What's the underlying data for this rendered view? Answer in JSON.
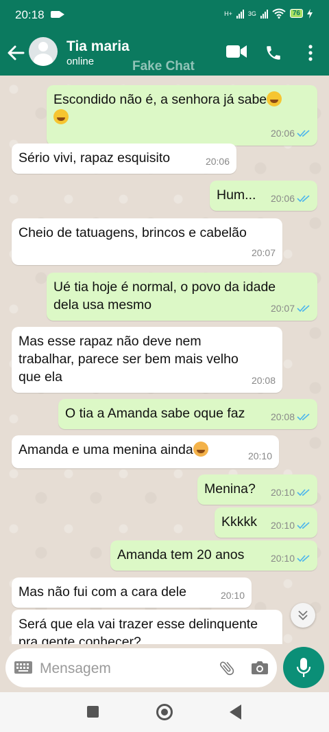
{
  "status_bar": {
    "time": "20:18",
    "network_1": "H+",
    "network_2": "3G",
    "battery": "76"
  },
  "header": {
    "contact_name": "Tia maria",
    "contact_status": "online",
    "watermark": "Fake Chat"
  },
  "colors": {
    "header": "#0b7a5f",
    "outgoing": "#dcf8c6",
    "incoming": "#ffffff",
    "tick": "#4fb6ec",
    "mic": "#0b8f77"
  },
  "messages": [
    {
      "dir": "out",
      "text": "Escondido não é, a senhora já sabe",
      "emoji": "joy-emoji",
      "time": "20:06"
    },
    {
      "dir": "in",
      "text": "Sério vivi, rapaz esquisito",
      "time": "20:06"
    },
    {
      "dir": "out",
      "text": "Hum...",
      "time": "20:06"
    },
    {
      "dir": "in",
      "text": "Cheio de tatuagens, brincos e cabelão",
      "time": "20:07"
    },
    {
      "dir": "out",
      "text": "Ué tia hoje é normal, o povo da idade dela usa mesmo",
      "time": "20:07"
    },
    {
      "dir": "in",
      "text": "Mas esse rapaz não deve nem trabalhar, parece ser bem mais velho que ela",
      "time": "20:08"
    },
    {
      "dir": "out",
      "text": "O tia a Amanda sabe oque faz",
      "time": "20:08"
    },
    {
      "dir": "in",
      "text": "Amanda e uma menina ainda",
      "emoji": "tired-face-emoji",
      "time": "20:10"
    },
    {
      "dir": "out",
      "text": "Menina?",
      "time": "20:10"
    },
    {
      "dir": "out",
      "text": "Kkkkk",
      "time": "20:10"
    },
    {
      "dir": "out",
      "text": "Amanda tem 20 anos",
      "time": "20:10"
    },
    {
      "dir": "in",
      "text": "Mas não fui com a cara dele",
      "time": "20:10"
    },
    {
      "dir": "in",
      "text": "Será que ela vai trazer esse delinquente pra gente conhecer?",
      "time": ""
    }
  ],
  "input": {
    "placeholder": "Mensagem"
  }
}
